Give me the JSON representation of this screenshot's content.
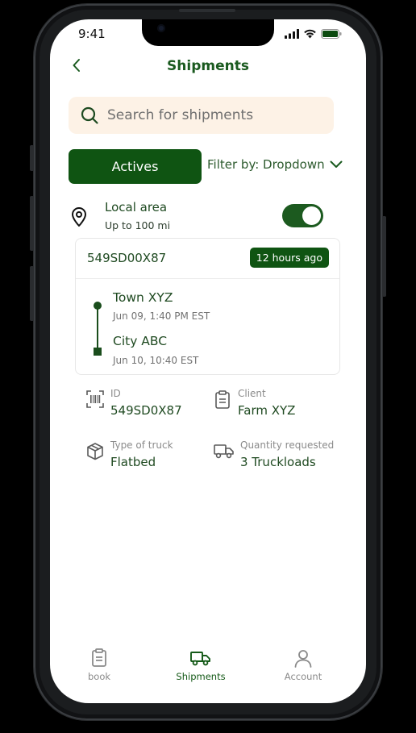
{
  "status_bar": {
    "time": "9:41"
  },
  "header": {
    "title": "Shipments"
  },
  "search": {
    "placeholder": "Search for shipments"
  },
  "filters": {
    "actives_label": "Actives",
    "filter_label": "Filter by: Dropdown"
  },
  "local_area": {
    "title": "Local area",
    "subtitle": "Up to 100 mi",
    "enabled": true
  },
  "shipment_card": {
    "id": "549SD00X87",
    "time_badge": "12 hours ago",
    "origin": {
      "name": "Town XYZ",
      "time": "Jun 09, 1:40 PM EST"
    },
    "destination": {
      "name": "City ABC",
      "time": "Jun 10, 10:40 EST"
    }
  },
  "details": {
    "id": {
      "label": "ID",
      "value": "549SD0X87",
      "icon": "barcode-icon"
    },
    "client": {
      "label": "Client",
      "value": "Farm XYZ",
      "icon": "clipboard-icon"
    },
    "truck": {
      "label": "Type of truck",
      "value": "Flatbed",
      "icon": "package-icon"
    },
    "quantity": {
      "label": "Quantity requested",
      "value": "3 Truckloads",
      "icon": "truck-icon"
    }
  },
  "nav": {
    "items": [
      {
        "label": "book",
        "icon": "clipboard-icon",
        "active": false
      },
      {
        "label": "Shipments",
        "icon": "truck-icon",
        "active": true
      },
      {
        "label": "Account",
        "icon": "user-icon",
        "active": false
      }
    ]
  },
  "colors": {
    "primary": "#0f5412",
    "text_green": "#1f4a21",
    "search_bg": "#fdf2e6"
  }
}
